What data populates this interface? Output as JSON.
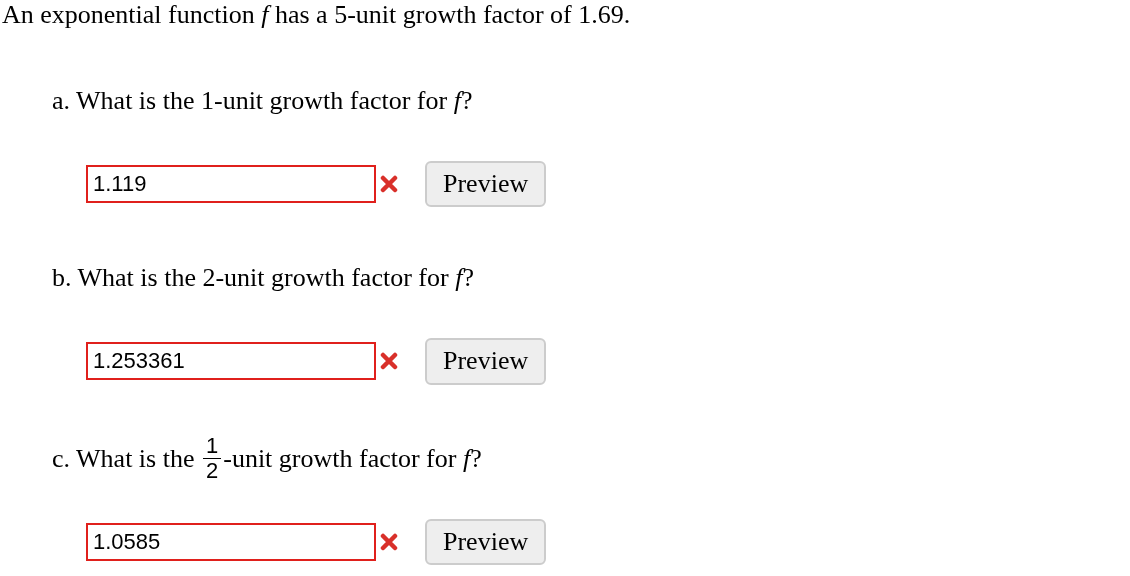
{
  "prompt": "An exponential function *f* has a 5-unit growth factor of 1.69.",
  "questions": [
    {
      "parts": [
        {
          "kind": "text",
          "text": "a. What is the 1-unit growth factor for *f*?"
        }
      ],
      "answer": {
        "value": "1.119",
        "correct": false
      },
      "button": "Preview"
    },
    {
      "parts": [
        {
          "kind": "text",
          "text": "b. What is the 2-unit growth factor for *f*?"
        }
      ],
      "answer": {
        "value": "1.253361",
        "correct": false
      },
      "button": "Preview"
    },
    {
      "parts": [
        {
          "kind": "text",
          "text": "c. What is the "
        },
        {
          "kind": "fraction",
          "numerator": "1",
          "denominator": "2"
        },
        {
          "kind": "text",
          "text": "-unit growth factor for *f*?"
        }
      ],
      "answer": {
        "value": "1.0585",
        "correct": false
      },
      "button": "Preview"
    }
  ]
}
